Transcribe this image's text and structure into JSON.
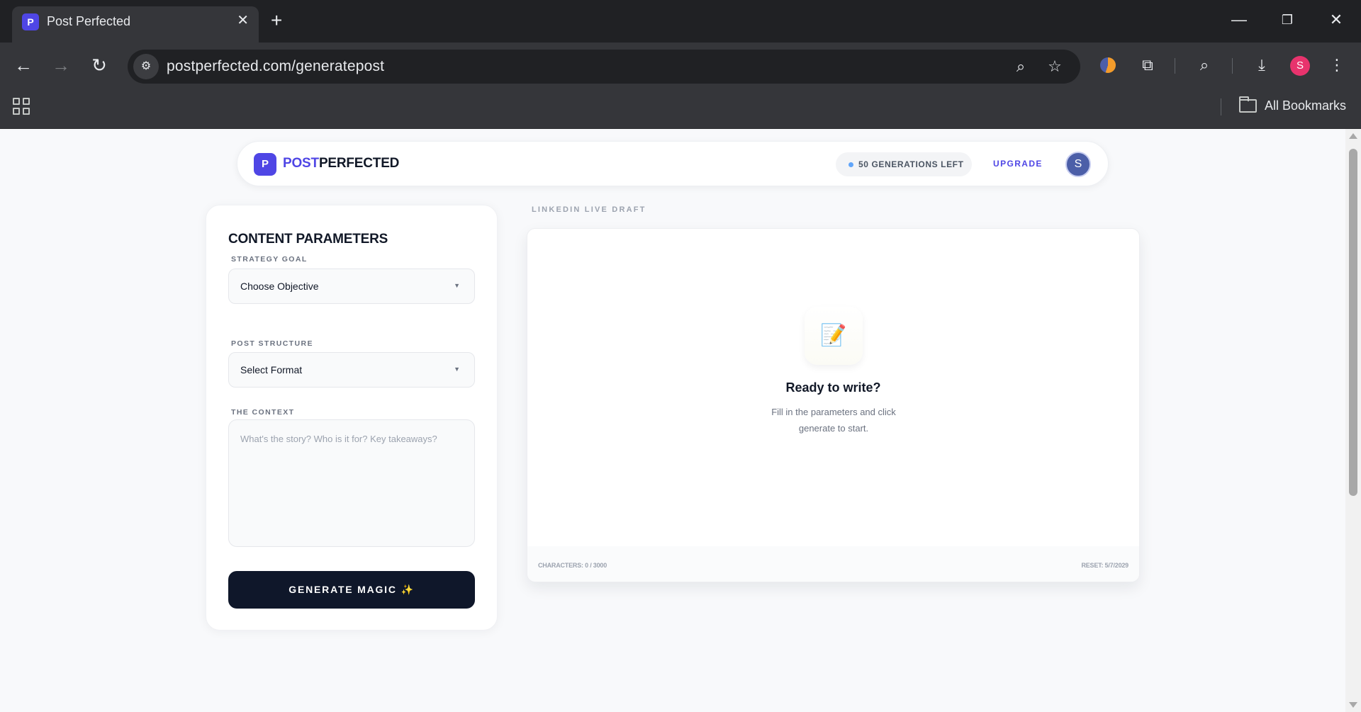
{
  "browser": {
    "tab_title": "Post Perfected",
    "tab_favicon_letter": "P",
    "url": "postperfected.com/generatepost",
    "profile_initial": "S",
    "bookmarks_label": "All Bookmarks"
  },
  "app": {
    "logo_letter": "P",
    "logo_post": "POST",
    "logo_perfected": "PERFECTED",
    "generations_left": "50 GENERATIONS LEFT",
    "upgrade_label": "UPGRADE",
    "avatar_initial": "S"
  },
  "params": {
    "title": "CONTENT PARAMETERS",
    "strategy_label": "STRATEGY GOAL",
    "strategy_value": "Choose Objective",
    "structure_label": "POST STRUCTURE",
    "structure_value": "Select Format",
    "context_label": "THE CONTEXT",
    "context_placeholder": "What's the story? Who is it for? Key takeaways?",
    "generate_label": "GENERATE MAGIC ✨"
  },
  "draft": {
    "section_label": "LINKEDIN LIVE DRAFT",
    "empty_icon": "📝",
    "empty_title": "Ready to write?",
    "empty_subtitle": "Fill in the parameters and click generate to start.",
    "characters": "CHARACTERS: 0 / 3000",
    "reset": "RESET: 5/7/2029"
  },
  "colors": {
    "brand": "#4f46e5",
    "button_dark": "#0f172a",
    "status_dot": "#60a5fa"
  }
}
